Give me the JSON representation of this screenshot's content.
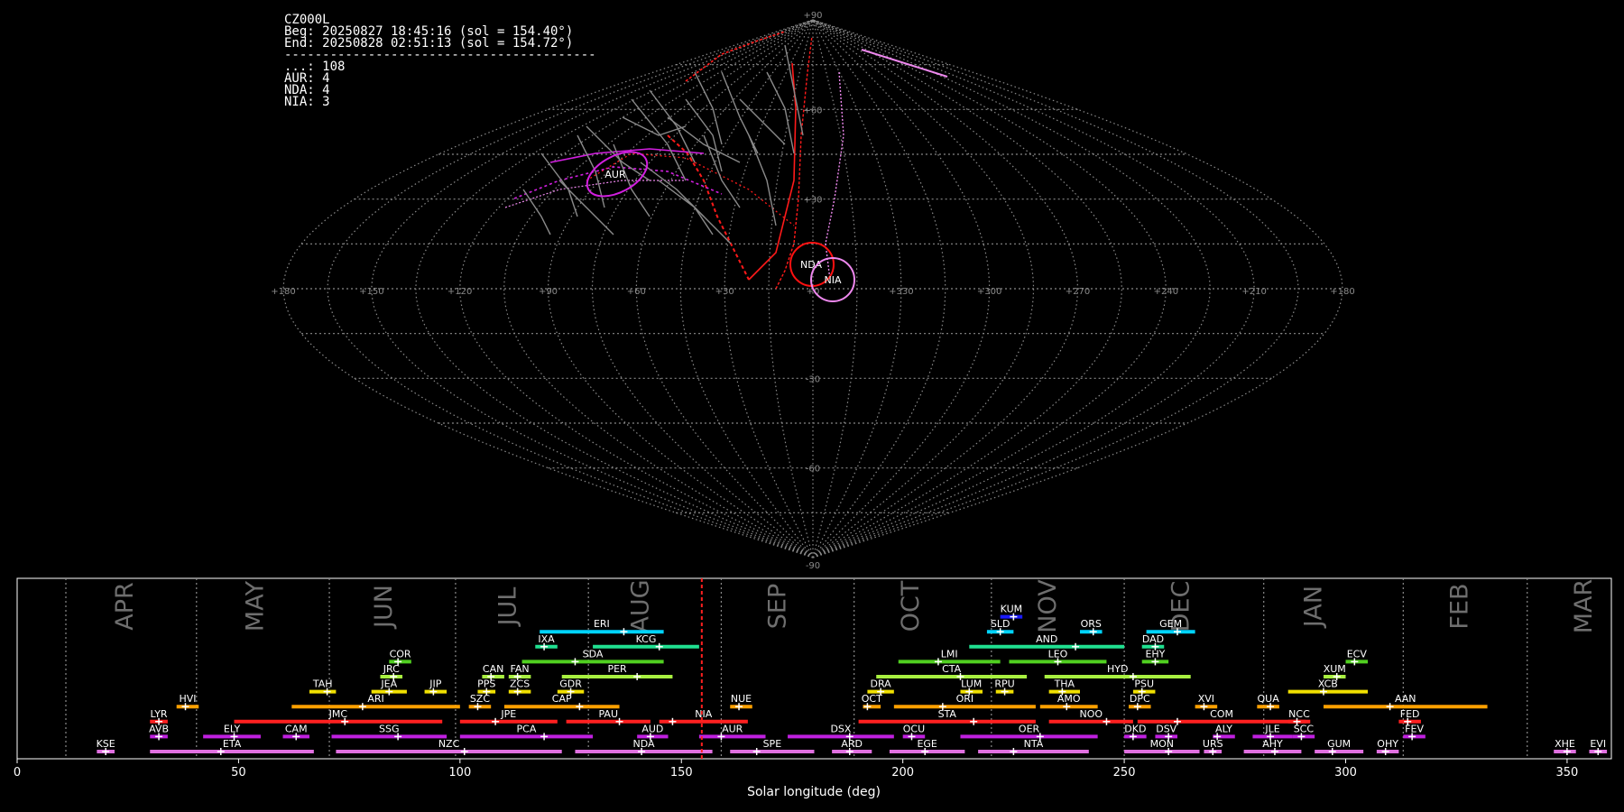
{
  "info": {
    "station": "CZ000L",
    "begin": "Beg: 20250827 18:45:16 (sol = 154.40°)",
    "end": "End: 20250828 02:51:13 (sol = 154.72°)",
    "separator": "-----------------------------------------",
    "counts": [
      {
        "code": "...",
        "count": 108
      },
      {
        "code": "AUR",
        "count": 4
      },
      {
        "code": "NDA",
        "count": 4
      },
      {
        "code": "NIA",
        "count": 3
      }
    ]
  },
  "sky_map": {
    "projection": "sinusoidal",
    "lon_labels": [
      "+180",
      "+150",
      "+120",
      "+90",
      "+60",
      "+30",
      "+0",
      "+330",
      "+300",
      "+270",
      "+240",
      "+210",
      "+180"
    ],
    "lat_labels": [
      "+90",
      "+60",
      "+30",
      "-30",
      "-60",
      "-90"
    ],
    "radiants": [
      {
        "name": "AUR",
        "color": "#d21fe0"
      },
      {
        "name": "NDA",
        "color": "#ff1010"
      },
      {
        "name": "NIA",
        "color": "#ee88ee"
      }
    ]
  },
  "timeline": {
    "xlabel": "Solar longitude (deg)",
    "xlim": [
      0,
      360
    ],
    "ticks": [
      0,
      50,
      100,
      150,
      200,
      250,
      300,
      350
    ],
    "current_sol": 154.6,
    "months": [
      {
        "name": "APR",
        "pos": 24.5
      },
      {
        "name": "MAY",
        "pos": 54
      },
      {
        "name": "JUN",
        "pos": 83
      },
      {
        "name": "JUL",
        "pos": 111
      },
      {
        "name": "AUG",
        "pos": 141
      },
      {
        "name": "SEP",
        "pos": 172
      },
      {
        "name": "OCT",
        "pos": 202
      },
      {
        "name": "NOV",
        "pos": 233
      },
      {
        "name": "DEC",
        "pos": 263
      },
      {
        "name": "JAN",
        "pos": 293
      },
      {
        "name": "FEB",
        "pos": 326
      },
      {
        "name": "MAR",
        "pos": 354
      }
    ],
    "month_dividers": [
      11,
      40.5,
      70.5,
      99,
      129,
      159,
      189,
      220,
      250,
      281.5,
      313,
      341
    ],
    "showers": [
      {
        "code": "KUM",
        "start": 222,
        "end": 227,
        "peak": 225,
        "row": 9,
        "color": "#1a1aff"
      },
      {
        "code": "ERI",
        "start": 118,
        "end": 146,
        "peak": 137,
        "row": 8,
        "color": "#00d4ff"
      },
      {
        "code": "SLD",
        "start": 219,
        "end": 225,
        "peak": 222,
        "row": 8,
        "color": "#00d4ff"
      },
      {
        "code": "ORS",
        "start": 240,
        "end": 245,
        "peak": 243,
        "row": 8,
        "color": "#00d4ff"
      },
      {
        "code": "GEM",
        "start": 255,
        "end": 266,
        "peak": 262,
        "row": 8,
        "color": "#00d4ff"
      },
      {
        "code": "IXA",
        "start": 117,
        "end": 122,
        "peak": 119,
        "row": 7,
        "color": "#20e090"
      },
      {
        "code": "KCG",
        "start": 130,
        "end": 154,
        "peak": 145,
        "row": 7,
        "color": "#20e090"
      },
      {
        "code": "AND",
        "start": 215,
        "end": 250,
        "peak": 239,
        "row": 7,
        "color": "#20e090"
      },
      {
        "code": "DAD",
        "start": 254,
        "end": 259,
        "peak": 257,
        "row": 7,
        "color": "#20e090"
      },
      {
        "code": "COR",
        "start": 84,
        "end": 89,
        "peak": 86,
        "row": 6,
        "color": "#50d020"
      },
      {
        "code": "SDA",
        "start": 114,
        "end": 146,
        "peak": 126,
        "row": 6,
        "color": "#50d020"
      },
      {
        "code": "LMI",
        "start": 199,
        "end": 222,
        "peak": 208,
        "row": 6,
        "color": "#50d020"
      },
      {
        "code": "LEO",
        "start": 224,
        "end": 246,
        "peak": 235,
        "row": 6,
        "color": "#50d020"
      },
      {
        "code": "EHY",
        "start": 254,
        "end": 260,
        "peak": 257,
        "row": 6,
        "color": "#50d020"
      },
      {
        "code": "ECV",
        "start": 300,
        "end": 305,
        "peak": 302,
        "row": 6,
        "color": "#50d020"
      },
      {
        "code": "JRC",
        "start": 82,
        "end": 87,
        "peak": 85,
        "row": 5,
        "color": "#a8f040"
      },
      {
        "code": "CAN",
        "start": 105,
        "end": 110,
        "peak": 107,
        "row": 5,
        "color": "#a8f040"
      },
      {
        "code": "FAN",
        "start": 111,
        "end": 116,
        "peak": 113,
        "row": 5,
        "color": "#a8f040"
      },
      {
        "code": "PER",
        "start": 123,
        "end": 148,
        "peak": 140,
        "row": 5,
        "color": "#a8f040"
      },
      {
        "code": "CTA",
        "start": 194,
        "end": 228,
        "peak": 213,
        "row": 5,
        "color": "#a8f040"
      },
      {
        "code": "HYD",
        "start": 232,
        "end": 265,
        "peak": 252,
        "row": 5,
        "color": "#a8f040"
      },
      {
        "code": "XUM",
        "start": 295,
        "end": 300,
        "peak": 298,
        "row": 5,
        "color": "#a8f040"
      },
      {
        "code": "TAH",
        "start": 66,
        "end": 72,
        "peak": 70,
        "row": 4,
        "color": "#f0e000"
      },
      {
        "code": "JEA",
        "start": 80,
        "end": 88,
        "peak": 84,
        "row": 4,
        "color": "#f0e000"
      },
      {
        "code": "JIP",
        "start": 92,
        "end": 97,
        "peak": 94,
        "row": 4,
        "color": "#f0e000"
      },
      {
        "code": "PPS",
        "start": 104,
        "end": 108,
        "peak": 106,
        "row": 4,
        "color": "#f0e000"
      },
      {
        "code": "ZCS",
        "start": 111,
        "end": 116,
        "peak": 113,
        "row": 4,
        "color": "#f0e000"
      },
      {
        "code": "GDR",
        "start": 122,
        "end": 128,
        "peak": 125,
        "row": 4,
        "color": "#f0e000"
      },
      {
        "code": "DRA",
        "start": 192,
        "end": 198,
        "peak": 195,
        "row": 4,
        "color": "#f0e000"
      },
      {
        "code": "LUM",
        "start": 213,
        "end": 218,
        "peak": 215,
        "row": 4,
        "color": "#f0e000"
      },
      {
        "code": "RPU",
        "start": 221,
        "end": 225,
        "peak": 223,
        "row": 4,
        "color": "#f0e000"
      },
      {
        "code": "THA",
        "start": 233,
        "end": 240,
        "peak": 236,
        "row": 4,
        "color": "#f0e000"
      },
      {
        "code": "PSU",
        "start": 252,
        "end": 257,
        "peak": 254,
        "row": 4,
        "color": "#f0e000"
      },
      {
        "code": "XCB",
        "start": 287,
        "end": 305,
        "peak": 295,
        "row": 4,
        "color": "#f0e000"
      },
      {
        "code": "HVI",
        "start": 36,
        "end": 41,
        "peak": 38,
        "row": 3,
        "color": "#ffa000"
      },
      {
        "code": "ARI",
        "start": 62,
        "end": 100,
        "peak": 78,
        "row": 3,
        "color": "#ffa000"
      },
      {
        "code": "SZC",
        "start": 102,
        "end": 107,
        "peak": 104,
        "row": 3,
        "color": "#ffa000"
      },
      {
        "code": "CAP",
        "start": 110,
        "end": 136,
        "peak": 127,
        "row": 3,
        "color": "#ffa000"
      },
      {
        "code": "NUE",
        "start": 161,
        "end": 166,
        "peak": 163,
        "row": 3,
        "color": "#ffa000"
      },
      {
        "code": "OCT",
        "start": 191,
        "end": 195,
        "peak": 192,
        "row": 3,
        "color": "#ffa000"
      },
      {
        "code": "ORI",
        "start": 198,
        "end": 230,
        "peak": 209,
        "row": 3,
        "color": "#ffa000"
      },
      {
        "code": "AMO",
        "start": 231,
        "end": 244,
        "peak": 237,
        "row": 3,
        "color": "#ffa000"
      },
      {
        "code": "DPC",
        "start": 251,
        "end": 256,
        "peak": 253,
        "row": 3,
        "color": "#ffa000"
      },
      {
        "code": "XVI",
        "start": 266,
        "end": 271,
        "peak": 268,
        "row": 3,
        "color": "#ffa000"
      },
      {
        "code": "QUA",
        "start": 280,
        "end": 285,
        "peak": 283,
        "row": 3,
        "color": "#ffa000"
      },
      {
        "code": "AAN",
        "start": 295,
        "end": 332,
        "peak": 310,
        "row": 3,
        "color": "#ffa000"
      },
      {
        "code": "LYR",
        "start": 30,
        "end": 34,
        "peak": 32,
        "row": 2,
        "color": "#ff2020"
      },
      {
        "code": "JMC",
        "start": 49,
        "end": 96,
        "peak": 74,
        "row": 2,
        "color": "#ff2020"
      },
      {
        "code": "JPE",
        "start": 100,
        "end": 122,
        "peak": 108,
        "row": 2,
        "color": "#ff2020"
      },
      {
        "code": "PAU",
        "start": 124,
        "end": 143,
        "peak": 136,
        "row": 2,
        "color": "#ff2020"
      },
      {
        "code": "NIA",
        "start": 145,
        "end": 165,
        "peak": 148,
        "row": 2,
        "color": "#ff2020"
      },
      {
        "code": "STA",
        "start": 190,
        "end": 230,
        "peak": 216,
        "row": 2,
        "color": "#ff2020"
      },
      {
        "code": "NOO",
        "start": 233,
        "end": 252,
        "peak": 246,
        "row": 2,
        "color": "#ff2020"
      },
      {
        "code": "COM",
        "start": 253,
        "end": 291,
        "peak": 262,
        "row": 2,
        "color": "#ff2020"
      },
      {
        "code": "NCC",
        "start": 287,
        "end": 292,
        "peak": 289,
        "row": 2,
        "color": "#ff2020"
      },
      {
        "code": "FED",
        "start": 312,
        "end": 317,
        "peak": 314,
        "row": 2,
        "color": "#ff2020"
      },
      {
        "code": "AVB",
        "start": 30,
        "end": 34,
        "peak": 32,
        "row": 1,
        "color": "#c020e0"
      },
      {
        "code": "ELY",
        "start": 42,
        "end": 55,
        "peak": 49,
        "row": 1,
        "color": "#c020e0"
      },
      {
        "code": "CAM",
        "start": 60,
        "end": 66,
        "peak": 63,
        "row": 1,
        "color": "#c020e0"
      },
      {
        "code": "SSG",
        "start": 71,
        "end": 97,
        "peak": 86,
        "row": 1,
        "color": "#c020e0"
      },
      {
        "code": "PCA",
        "start": 100,
        "end": 130,
        "peak": 119,
        "row": 1,
        "color": "#c020e0"
      },
      {
        "code": "AUD",
        "start": 140,
        "end": 147,
        "peak": 143,
        "row": 1,
        "color": "#c020e0"
      },
      {
        "code": "AUR",
        "start": 154,
        "end": 169,
        "peak": 159,
        "row": 1,
        "color": "#c020e0"
      },
      {
        "code": "DSX",
        "start": 174,
        "end": 198,
        "peak": 188,
        "row": 1,
        "color": "#c020e0"
      },
      {
        "code": "OCU",
        "start": 200,
        "end": 205,
        "peak": 202,
        "row": 1,
        "color": "#c020e0"
      },
      {
        "code": "OER",
        "start": 213,
        "end": 244,
        "peak": 231,
        "row": 1,
        "color": "#c020e0"
      },
      {
        "code": "DKD",
        "start": 250,
        "end": 255,
        "peak": 252,
        "row": 1,
        "color": "#c020e0"
      },
      {
        "code": "DSV",
        "start": 257,
        "end": 262,
        "peak": 260,
        "row": 1,
        "color": "#c020e0"
      },
      {
        "code": "ALY",
        "start": 270,
        "end": 275,
        "peak": 271,
        "row": 1,
        "color": "#c020e0"
      },
      {
        "code": "JLE",
        "start": 279,
        "end": 288,
        "peak": 283,
        "row": 1,
        "color": "#c020e0"
      },
      {
        "code": "SCC",
        "start": 288,
        "end": 293,
        "peak": 290,
        "row": 1,
        "color": "#c020e0"
      },
      {
        "code": "FEV",
        "start": 313,
        "end": 318,
        "peak": 315,
        "row": 1,
        "color": "#c020e0"
      },
      {
        "code": "KSE",
        "start": 18,
        "end": 22,
        "peak": 20,
        "row": 0,
        "color": "#e070e0"
      },
      {
        "code": "ETA",
        "start": 30,
        "end": 67,
        "peak": 46,
        "row": 0,
        "color": "#e070e0"
      },
      {
        "code": "NZC",
        "start": 72,
        "end": 123,
        "peak": 101,
        "row": 0,
        "color": "#e070e0"
      },
      {
        "code": "NDA",
        "start": 126,
        "end": 157,
        "peak": 141,
        "row": 0,
        "color": "#e070e0"
      },
      {
        "code": "SPE",
        "start": 161,
        "end": 180,
        "peak": 167,
        "row": 0,
        "color": "#e070e0"
      },
      {
        "code": "ARD",
        "start": 184,
        "end": 193,
        "peak": 188,
        "row": 0,
        "color": "#e070e0"
      },
      {
        "code": "EGE",
        "start": 197,
        "end": 214,
        "peak": 205,
        "row": 0,
        "color": "#e070e0"
      },
      {
        "code": "NTA",
        "start": 217,
        "end": 242,
        "peak": 225,
        "row": 0,
        "color": "#e070e0"
      },
      {
        "code": "MON",
        "start": 250,
        "end": 267,
        "peak": 260,
        "row": 0,
        "color": "#e070e0"
      },
      {
        "code": "URS",
        "start": 268,
        "end": 272,
        "peak": 270,
        "row": 0,
        "color": "#e070e0"
      },
      {
        "code": "AHY",
        "start": 277,
        "end": 290,
        "peak": 284,
        "row": 0,
        "color": "#e070e0"
      },
      {
        "code": "GUM",
        "start": 293,
        "end": 304,
        "peak": 297,
        "row": 0,
        "color": "#e070e0"
      },
      {
        "code": "OHY",
        "start": 307,
        "end": 312,
        "peak": 309,
        "row": 0,
        "color": "#e070e0"
      },
      {
        "code": "XHE",
        "start": 347,
        "end": 352,
        "peak": 350,
        "row": 0,
        "color": "#e070e0"
      },
      {
        "code": "EVI",
        "start": 355,
        "end": 359,
        "peak": 357,
        "row": 0,
        "color": "#e070e0"
      }
    ]
  }
}
